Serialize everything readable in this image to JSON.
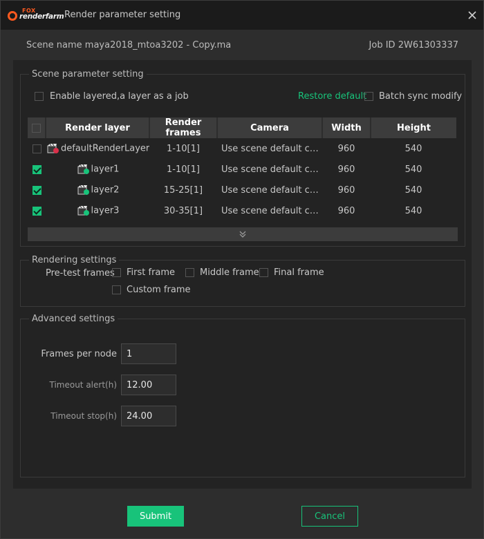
{
  "window": {
    "title": "Render parameter setting",
    "logo_top": "FOX",
    "logo_main": "renderfarm"
  },
  "info": {
    "scene_label": "Scene name",
    "scene_value": "maya2018_mtoa3202 - Copy.ma",
    "job_label": "Job ID",
    "job_value": "2W61303337"
  },
  "scene_params": {
    "legend": "Scene parameter setting",
    "enable_layered_label": "Enable layered,a layer as a job",
    "enable_layered_checked": false,
    "restore_default": "Restore default",
    "batch_sync_label": "Batch sync modify",
    "batch_sync_checked": false,
    "table": {
      "headers": [
        "Render layer",
        "Render frames",
        "Camera",
        "Width",
        "Height"
      ],
      "rows": [
        {
          "checked": false,
          "layer": "defaultRenderLayer",
          "frames": "1-10[1]",
          "camera": "Use scene default cam...",
          "width": "960",
          "height": "540",
          "icon_state": "disabled"
        },
        {
          "checked": true,
          "layer": "layer1",
          "frames": "1-10[1]",
          "camera": "Use scene default cam...",
          "width": "960",
          "height": "540",
          "icon_state": "enabled"
        },
        {
          "checked": true,
          "layer": "layer2",
          "frames": "15-25[1]",
          "camera": "Use scene default cam...",
          "width": "960",
          "height": "540",
          "icon_state": "enabled"
        },
        {
          "checked": true,
          "layer": "layer3",
          "frames": "30-35[1]",
          "camera": "Use scene default cam...",
          "width": "960",
          "height": "540",
          "icon_state": "enabled"
        }
      ]
    }
  },
  "rendering": {
    "legend": "Rendering settings",
    "pretest_label": "Pre-test frames",
    "options": [
      {
        "label": "First frame",
        "checked": false
      },
      {
        "label": "Middle frame",
        "checked": false
      },
      {
        "label": "Final frame",
        "checked": false
      },
      {
        "label": "Custom frame",
        "checked": false
      }
    ]
  },
  "advanced": {
    "legend": "Advanced settings",
    "frames_per_node_label": "Frames per node",
    "frames_per_node_value": "1",
    "timeout_alert_label": "Timeout alert(h)",
    "timeout_alert_value": "12.00",
    "timeout_stop_label": "Timeout stop(h)",
    "timeout_stop_value": "24.00"
  },
  "actions": {
    "submit": "Submit",
    "cancel": "Cancel"
  },
  "colors": {
    "accent": "#18c37a",
    "logo": "#ff5a1f",
    "background": "#2d2d2d",
    "panel": "#232323"
  }
}
